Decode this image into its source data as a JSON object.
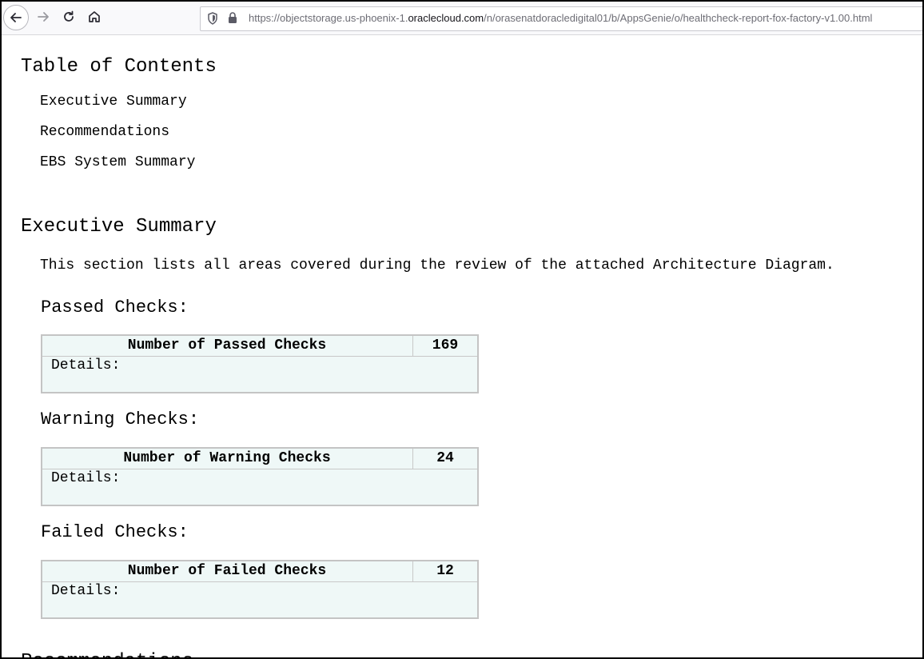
{
  "browser": {
    "url_prefix": "https://objectstorage.us-phoenix-1.",
    "url_domain": "oraclecloud.com",
    "url_suffix": "/n/orasenatdoracledigital01/b/AppsGenie/o/healthcheck-report-fox-factory-v1.00.html",
    "icons": [
      "back-arrow-icon",
      "forward-arrow-icon",
      "reload-icon",
      "home-icon",
      "shield-icon",
      "lock-icon"
    ]
  },
  "toc": {
    "title": "Table of Contents",
    "items": [
      "Executive Summary",
      "Recommendations",
      "EBS System Summary"
    ]
  },
  "executive_summary": {
    "title": "Executive Summary",
    "intro": "This section lists all areas covered during the review of the attached Architecture Diagram.",
    "sections": [
      {
        "heading": "Passed Checks:",
        "label": "Number of Passed Checks",
        "count": "169",
        "details": "Details:"
      },
      {
        "heading": "Warning Checks:",
        "label": "Number of Warning Checks",
        "count": "24",
        "details": "Details:"
      },
      {
        "heading": "Failed Checks:",
        "label": "Number of Failed Checks",
        "count": "12",
        "details": "Details:"
      }
    ]
  },
  "next_heading": "Recommendations",
  "colors": {
    "table_bg": "#eff8f7",
    "table_border": "#c4c4c4"
  }
}
